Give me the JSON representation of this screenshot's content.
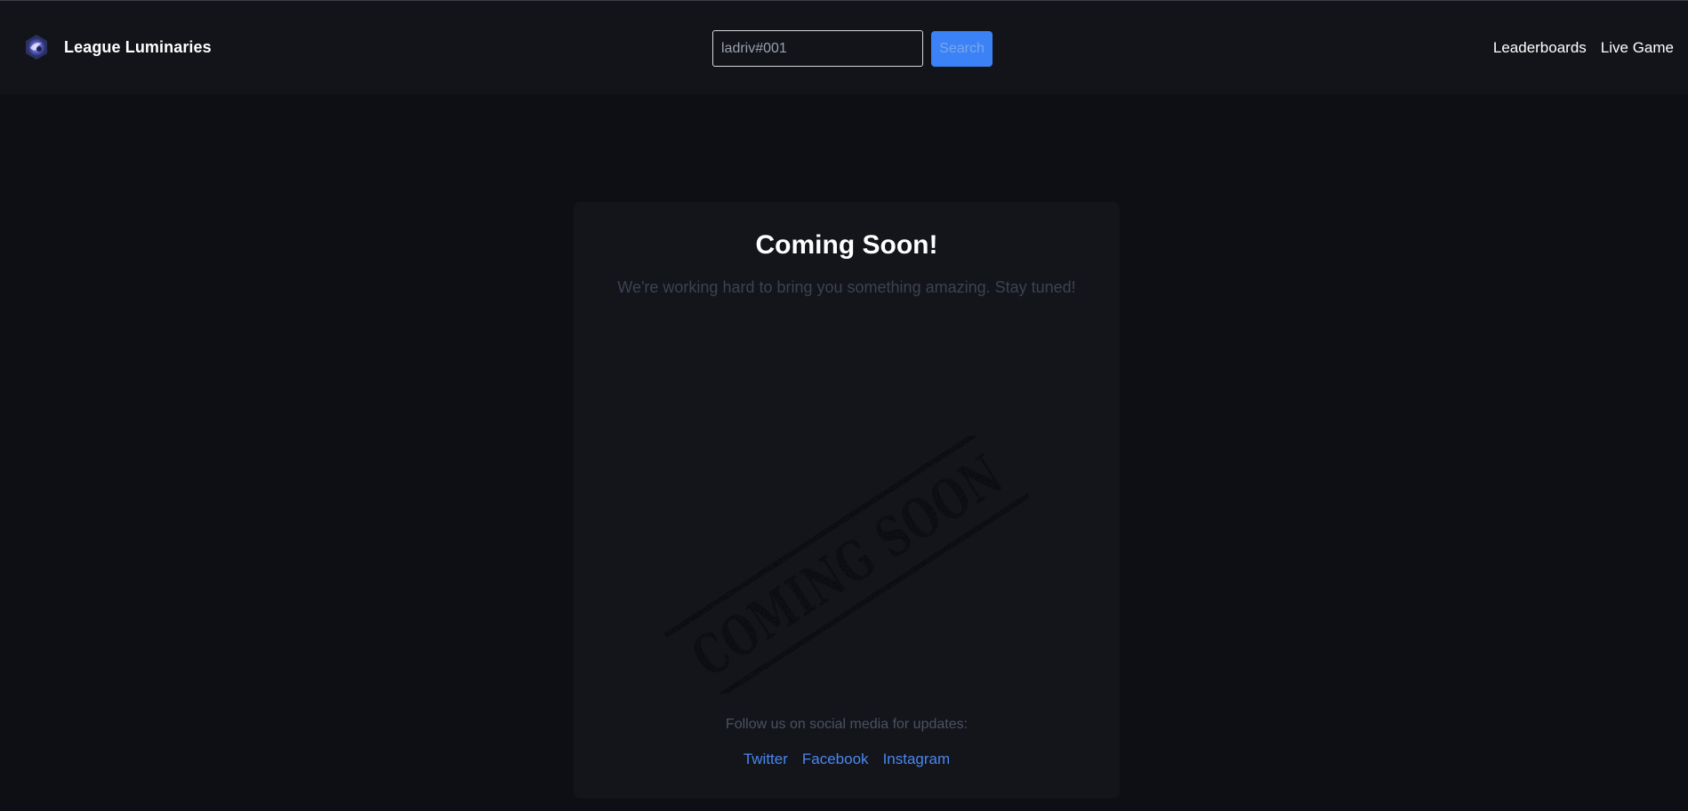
{
  "header": {
    "brand_name": "League Luminaries",
    "logo_icon": "league-luminaries-logo-icon",
    "search": {
      "value": "ladriv#001",
      "button_label": "Search"
    },
    "nav": [
      {
        "label": "Leaderboards"
      },
      {
        "label": "Live Game"
      }
    ]
  },
  "main": {
    "title": "Coming Soon!",
    "subtitle": "We're working hard to bring you something amazing. Stay tuned!",
    "stamp_text": "COMING SOON",
    "follow_text": "Follow us on social media for updates:",
    "social_links": [
      {
        "label": "Twitter"
      },
      {
        "label": "Facebook"
      },
      {
        "label": "Instagram"
      }
    ]
  },
  "colors": {
    "page_background": "#0d0f14",
    "navbar_background": "#12141a",
    "card_background": "#13151b",
    "accent": "#3b82f6",
    "link": "#4a86f0"
  }
}
